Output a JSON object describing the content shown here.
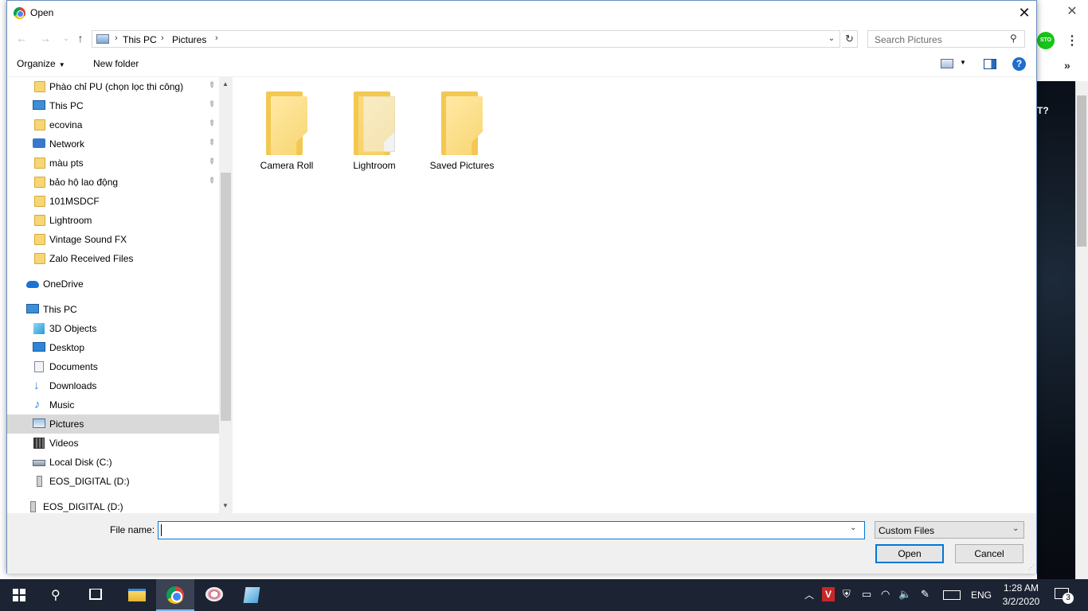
{
  "dialog": {
    "title": "Open",
    "close_glyph": "✕"
  },
  "nav": {
    "back_glyph": "←",
    "forward_glyph": "→",
    "recent_glyph": "⌄",
    "up_glyph": "↑",
    "breadcrumbs": [
      "This PC",
      "Pictures"
    ],
    "separator": "›",
    "dropdown_glyph": "⌄",
    "refresh_glyph": "↻",
    "search_placeholder": "Search Pictures",
    "search_icon": "search-icon"
  },
  "toolbar": {
    "organize_label": "Organize",
    "newfolder_label": "New folder",
    "help_label": "?"
  },
  "navpane": {
    "quick_access": [
      {
        "label": "Phào chỉ PU (chọn lọc thi công)",
        "icon": "folder-icon",
        "pinned": true
      },
      {
        "label": "This PC",
        "icon": "computer-icon",
        "pinned": true
      },
      {
        "label": "ecovina",
        "icon": "folder-icon",
        "pinned": true
      },
      {
        "label": "Network",
        "icon": "network-icon",
        "pinned": true
      },
      {
        "label": "màu pts",
        "icon": "folder-icon",
        "pinned": true
      },
      {
        "label": "bảo hộ lao động",
        "icon": "folder-icon",
        "pinned": true
      },
      {
        "label": "101MSDCF",
        "icon": "folder-icon",
        "pinned": false
      },
      {
        "label": "Lightroom",
        "icon": "folder-icon",
        "pinned": false
      },
      {
        "label": "Vintage Sound FX",
        "icon": "folder-icon",
        "pinned": false
      },
      {
        "label": "Zalo Received Files",
        "icon": "folder-icon",
        "pinned": false
      }
    ],
    "onedrive": "OneDrive",
    "thispc": "This PC",
    "thispc_items": [
      {
        "label": "3D Objects",
        "icon": "cube-icon"
      },
      {
        "label": "Desktop",
        "icon": "desktop-icon"
      },
      {
        "label": "Documents",
        "icon": "document-icon"
      },
      {
        "label": "Downloads",
        "icon": "download-icon"
      },
      {
        "label": "Music",
        "icon": "music-icon"
      },
      {
        "label": "Pictures",
        "icon": "pictures-icon",
        "selected": true
      },
      {
        "label": "Videos",
        "icon": "video-icon"
      },
      {
        "label": "Local Disk (C:)",
        "icon": "disk-icon"
      },
      {
        "label": "EOS_DIGITAL (D:)",
        "icon": "usb-drive-icon"
      }
    ],
    "drive_root": "EOS_DIGITAL (D:)",
    "pin_glyph": "📌"
  },
  "content": {
    "folders": [
      {
        "label": "Camera Roll",
        "kind": "empty"
      },
      {
        "label": "Lightroom",
        "kind": "with-files"
      },
      {
        "label": "Saved Pictures",
        "kind": "empty"
      }
    ]
  },
  "bottom": {
    "filename_label": "File name:",
    "filename_value": "",
    "filetype_value": "Custom Files",
    "open_label": "Open",
    "cancel_label": "Cancel"
  },
  "background": {
    "profile_text": "STO",
    "partial_text": "T?",
    "more_glyph": "»",
    "menu_glyph": "⋮"
  },
  "taskbar": {
    "lang": "ENG",
    "time": "1:28 AM",
    "date": "3/2/2020",
    "notification_count": "3",
    "tray_v_label": "V"
  },
  "colors": {
    "accent": "#0078d7",
    "taskbar_bg": "#1c2433",
    "selected_row": "#d9d9d9",
    "folder": "#f7d675"
  }
}
